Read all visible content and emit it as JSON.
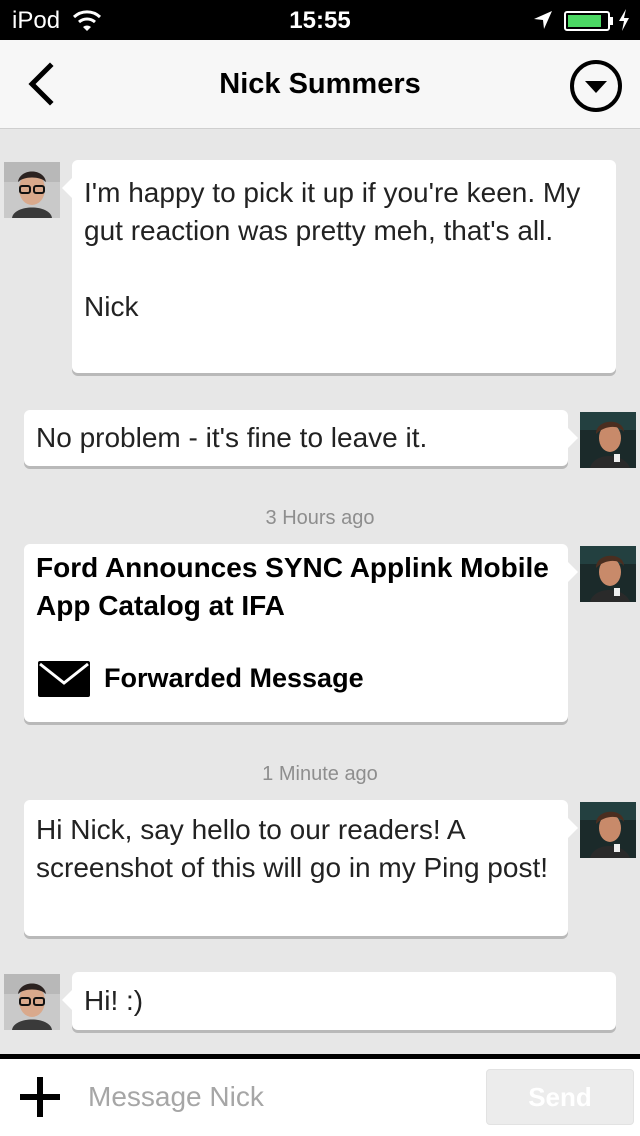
{
  "status_bar": {
    "carrier": "iPod",
    "time": "15:55"
  },
  "nav": {
    "title": "Nick Summers"
  },
  "messages": [
    {
      "text": "I'm happy to pick it up if you're keen. My gut reaction was pretty meh, that's all.\n\nNick"
    },
    {
      "text": "No problem - it's fine to leave it."
    },
    {
      "timestamp": "3 Hours ago",
      "forward_title": "Ford Announces SYNC Applink Mobile App Catalog at IFA",
      "forward_label": "Forwarded Message"
    },
    {
      "timestamp": "1 Minute ago",
      "text": "Hi Nick, say hello to our readers! A screenshot of this will go in my Ping post!"
    },
    {
      "text": "Hi! :)"
    }
  ],
  "composer": {
    "placeholder": "Message Nick",
    "send_label": "Send"
  },
  "colors": {
    "nav_background": "#f7f7f7",
    "chat_background": "#e7e7e7",
    "bubble": "#ffffff",
    "battery": "#4cd964"
  }
}
